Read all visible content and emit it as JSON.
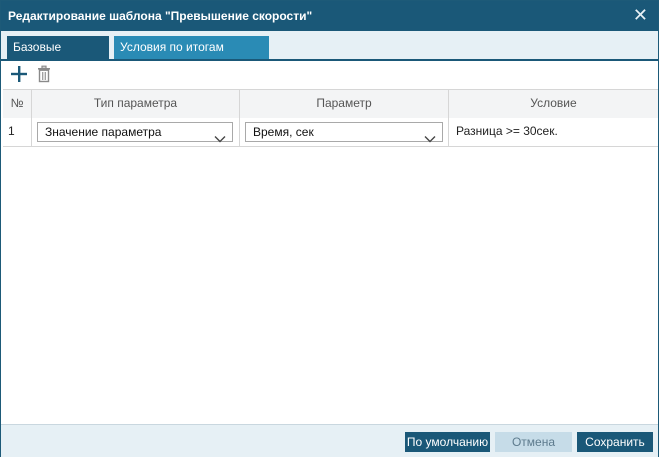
{
  "dialog": {
    "title": "Редактирование шаблона \"Превышение скорости\"",
    "close_glyph": "✕"
  },
  "tabs": [
    {
      "label": "Базовые условия",
      "active": true
    },
    {
      "label": "Условия по итогам события",
      "active": false
    }
  ],
  "toolbar": {
    "add_icon": "plus-icon",
    "delete_icon": "trash-icon"
  },
  "table": {
    "columns": [
      "№",
      "Тип параметра",
      "Параметр",
      "Условие"
    ],
    "rows": [
      {
        "num": "1",
        "param_type": "Значение параметра",
        "param": "Время, сек",
        "condition": "Разница >= 30сек."
      }
    ]
  },
  "footer": {
    "default_label": "По умолчанию",
    "cancel_label": "Отмена",
    "save_label": "Сохранить"
  },
  "colors": {
    "header": "#1a5878",
    "tab_inactive": "#2a8bb5",
    "panel": "#e6f0f5"
  }
}
